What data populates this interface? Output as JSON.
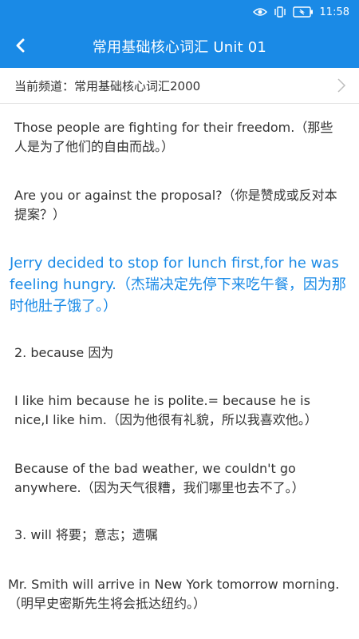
{
  "status": {
    "time": "11:58",
    "icons": [
      "eye-icon",
      "vibrate-icon",
      "battery-icon"
    ]
  },
  "header": {
    "title": "常用基础核心词汇 Unit 01",
    "back_icon": "chevron-left-icon"
  },
  "channel": {
    "label": "当前频道：常用基础核心词汇2000",
    "chevron_icon": "chevron-right-icon"
  },
  "paragraphs": [
    {
      "text": "Those people are fighting for their freedom.（那些人是为了他们的自由而战。）"
    },
    {
      "text": "Are you or against the proposal?（你是赞成或反对本提案？）"
    },
    {
      "text": "Jerry decided to stop for lunch first,for he was feeling hungry.（杰瑞决定先停下来吃午餐，因为那时他肚子饿了。）",
      "highlighted": true
    },
    {
      "text": "2. because 因为"
    },
    {
      "text": "I like him because he is polite.= because he is nice,I like him.（因为他很有礼貌，所以我喜欢他。）"
    },
    {
      "text": "Because of the bad weather, we couldn't go anywhere.（因为天气很糟，我们哪里也去不了。）"
    },
    {
      "text": "3. will 将要；意志；遗嘱"
    },
    {
      "text": "Mr. Smith will arrive in New York tomorrow morning.（明早史密斯先生将会抵达纽约。）"
    }
  ],
  "colors": {
    "accent": "#1a8ae6",
    "text": "#333333",
    "divider": "#e5e5e5"
  }
}
